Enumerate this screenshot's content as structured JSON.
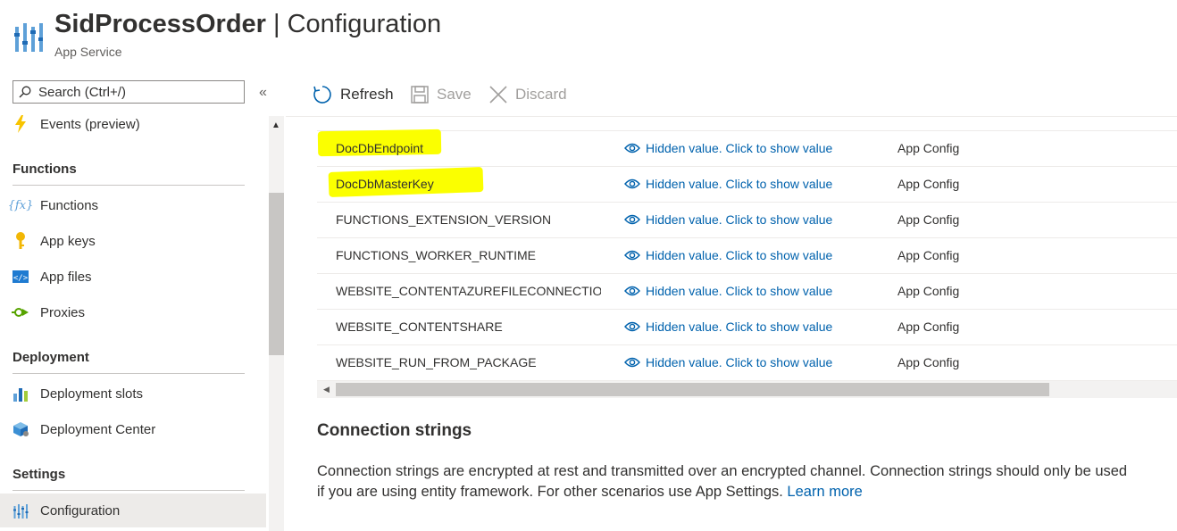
{
  "header": {
    "app_name": "SidProcessOrder",
    "separator": " | ",
    "page": "Configuration",
    "subtitle": "App Service"
  },
  "sidebar": {
    "search_placeholder": "Search (Ctrl+/)",
    "collapse_glyph": "«",
    "top_item": {
      "label": "Events (preview)",
      "icon": "lightning-icon"
    },
    "groups": [
      {
        "title": "Functions",
        "items": [
          {
            "label": "Functions",
            "icon": "function-icon"
          },
          {
            "label": "App keys",
            "icon": "key-icon"
          },
          {
            "label": "App files",
            "icon": "code-file-icon"
          },
          {
            "label": "Proxies",
            "icon": "proxy-icon"
          }
        ]
      },
      {
        "title": "Deployment",
        "items": [
          {
            "label": "Deployment slots",
            "icon": "slots-icon"
          },
          {
            "label": "Deployment Center",
            "icon": "deployment-center-icon"
          }
        ]
      },
      {
        "title": "Settings",
        "items": [
          {
            "label": "Configuration",
            "icon": "configuration-icon",
            "active": true
          }
        ]
      }
    ]
  },
  "toolbar": {
    "refresh": "Refresh",
    "save": "Save",
    "discard": "Discard"
  },
  "settings_table": {
    "hidden_value_text": "Hidden value. Click to show value",
    "rows": [
      {
        "name": "DocDbEndpoint",
        "source": "App Config",
        "highlighted": true
      },
      {
        "name": "DocDbMasterKey",
        "source": "App Config",
        "highlighted": true
      },
      {
        "name": "FUNCTIONS_EXTENSION_VERSION",
        "source": "App Config"
      },
      {
        "name": "FUNCTIONS_WORKER_RUNTIME",
        "source": "App Config"
      },
      {
        "name": "WEBSITE_CONTENTAZUREFILECONNECTIONSTRING",
        "source": "App Config"
      },
      {
        "name": "WEBSITE_CONTENTSHARE",
        "source": "App Config"
      },
      {
        "name": "WEBSITE_RUN_FROM_PACKAGE",
        "source": "App Config"
      }
    ]
  },
  "connection_strings": {
    "title": "Connection strings",
    "line1": "Connection strings are encrypted at rest and transmitted over an encrypted channel. Connection strings should only be used",
    "line2": "if you are using entity framework. For other scenarios use App Settings. ",
    "learn_more": "Learn more"
  },
  "colors": {
    "link": "#0062ad",
    "highlight": "#fbff00",
    "active_nav": "#edebe9",
    "lightning": "#f8c400",
    "key": "#f2b705",
    "proxy": "#57a300"
  }
}
